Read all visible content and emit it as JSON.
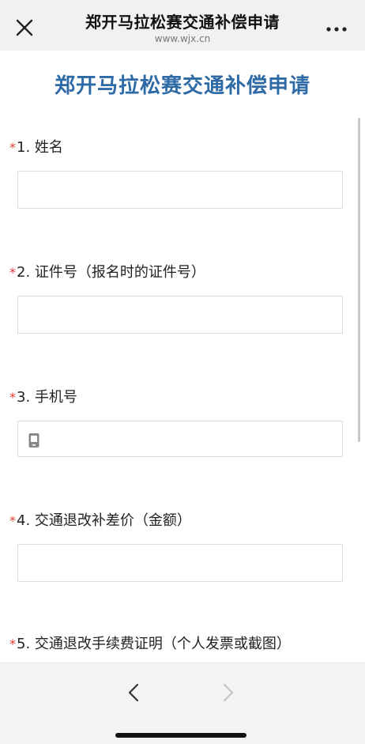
{
  "topbar": {
    "title": "郑开马拉松赛交通补偿申请",
    "url": "www.wjx.cn"
  },
  "form": {
    "title": "郑开马拉松赛交通补偿申请",
    "required_mark": "*",
    "questions": [
      {
        "label": "1. 姓名",
        "value": ""
      },
      {
        "label": "2. 证件号（报名时的证件号）",
        "value": ""
      },
      {
        "label": "3. 手机号",
        "value": "",
        "icon": "phone-icon"
      },
      {
        "label": "4. 交通退改补差价（金额）",
        "value": ""
      },
      {
        "label": "5. 交通退改手续费证明（个人发票或截图）"
      }
    ]
  },
  "icons": {
    "close": "close-icon",
    "more": "more-icon",
    "back": "chevron-left-icon",
    "forward": "chevron-right-icon"
  },
  "colors": {
    "title_blue": "#2e6aa6",
    "required_red": "#e03b3b",
    "forward_disabled": "#c4c4c4"
  }
}
